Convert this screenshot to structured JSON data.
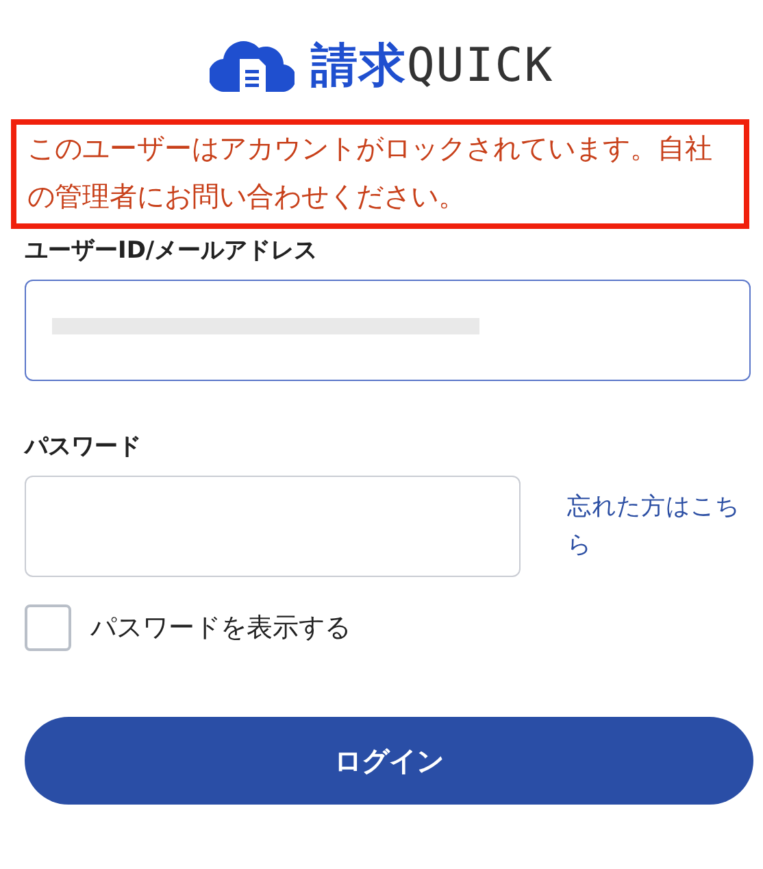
{
  "logo": {
    "parts": [
      "請求",
      "QUICK"
    ]
  },
  "error_message": "このユーザーはアカウントがロックされています。自社の管理者にお問い合わせください。",
  "fields": [
    {
      "kind": "email",
      "label": "ユーザーID/メールアドレス",
      "focused": true,
      "redacted": true
    },
    {
      "kind": "password",
      "label": "パスワード",
      "focused": false,
      "link": "忘れた方はこちら"
    }
  ],
  "show_password": {
    "label": "パスワードを表示する",
    "checked": false
  },
  "login_button": "ログイン"
}
